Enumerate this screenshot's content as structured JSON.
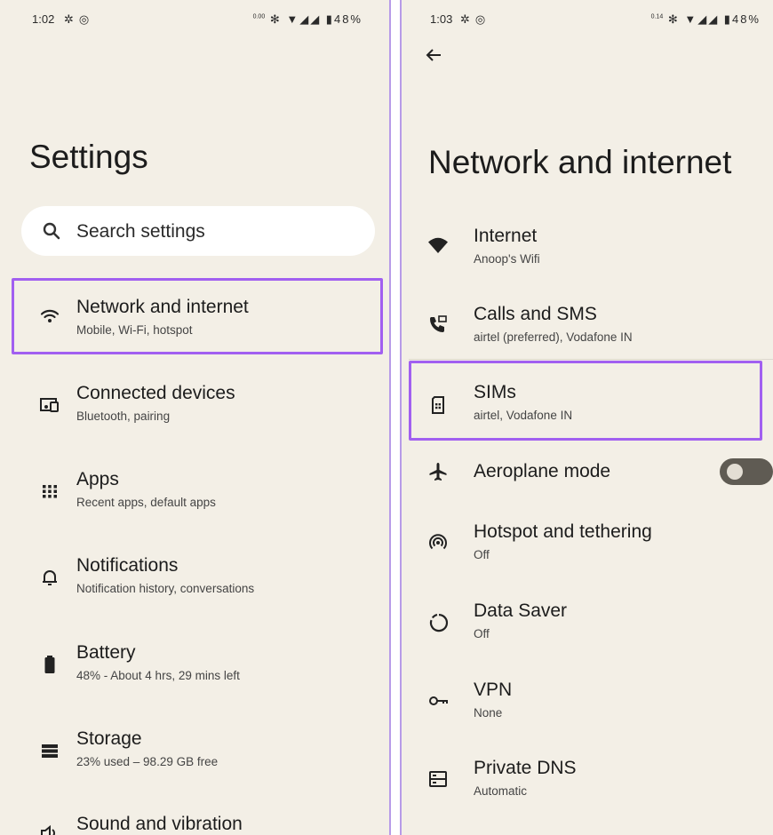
{
  "left": {
    "status": {
      "time": "1:02",
      "net_speed": "0.00",
      "battery": "48%"
    },
    "title": "Settings",
    "search": {
      "placeholder": "Search settings"
    },
    "items": [
      {
        "title": "Network and internet",
        "subtitle": "Mobile, Wi-Fi, hotspot",
        "icon": "wifi-icon",
        "highlighted": true
      },
      {
        "title": "Connected devices",
        "subtitle": "Bluetooth, pairing",
        "icon": "devices-icon"
      },
      {
        "title": "Apps",
        "subtitle": "Recent apps, default apps",
        "icon": "apps-grid-icon"
      },
      {
        "title": "Notifications",
        "subtitle": "Notification history, conversations",
        "icon": "bell-icon"
      },
      {
        "title": "Battery",
        "subtitle": "48% - About 4 hrs, 29 mins left",
        "icon": "battery-icon"
      },
      {
        "title": "Storage",
        "subtitle": "23% used – 98.29 GB free",
        "icon": "storage-icon"
      },
      {
        "title": "Sound and vibration",
        "subtitle": "",
        "icon": "speaker-icon"
      }
    ]
  },
  "right": {
    "status": {
      "time": "1:03",
      "net_speed": "0.14",
      "battery": "48%"
    },
    "title": "Network and internet",
    "items": [
      {
        "title": "Internet",
        "subtitle": "Anoop's Wifi",
        "icon": "wifi-filled-icon"
      },
      {
        "title": "Calls and SMS",
        "subtitle": "airtel (preferred), Vodafone IN",
        "icon": "calls-sms-icon"
      },
      {
        "title": "SIMs",
        "subtitle": "airtel, Vodafone IN",
        "icon": "sim-card-icon",
        "highlighted": true
      },
      {
        "title": "Aeroplane mode",
        "subtitle": "",
        "icon": "airplane-icon",
        "toggle": false
      },
      {
        "title": "Hotspot and tethering",
        "subtitle": "Off",
        "icon": "hotspot-icon"
      },
      {
        "title": "Data Saver",
        "subtitle": "Off",
        "icon": "data-saver-icon"
      },
      {
        "title": "VPN",
        "subtitle": "None",
        "icon": "vpn-key-icon"
      },
      {
        "title": "Private DNS",
        "subtitle": "Automatic",
        "icon": "dns-icon"
      }
    ]
  },
  "colors": {
    "background": "#f3efe6",
    "highlight": "#a15ff0",
    "toggle_off": "#5f5b53"
  }
}
